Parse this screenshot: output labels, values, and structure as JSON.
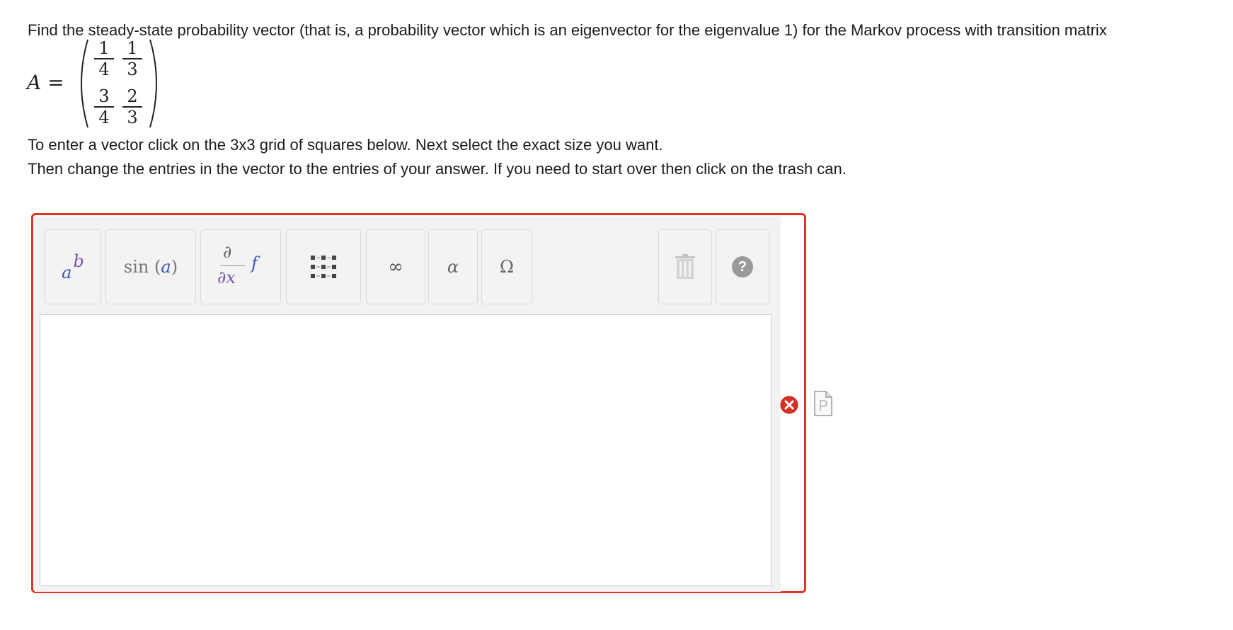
{
  "question": {
    "prompt": "Find the steady-state probability vector (that is, a probability vector which is an eigenvector for the eigenvalue 1) for the Markov process with transition matrix",
    "matrix_lhs_var": "A",
    "matrix_lhs_eq": "=",
    "matrix": [
      [
        {
          "num": "1",
          "den": "4"
        },
        {
          "num": "1",
          "den": "3"
        }
      ],
      [
        {
          "num": "3",
          "den": "4"
        },
        {
          "num": "2",
          "den": "3"
        }
      ]
    ],
    "instructions_1": "To enter a vector click on the 3x3 grid of squares below. Next select the exact size you want.",
    "instructions_2": "Then change the entries in the vector to the entries of your answer. If you need to start over then click on the trash can."
  },
  "toolbar": {
    "superscript": {
      "base": "a",
      "exp": "b"
    },
    "functions": {
      "fn": "sin",
      "open": "(",
      "arg": "a",
      "close": ")"
    },
    "calculus": {
      "partial_top": "∂",
      "partial_bottom": "∂x",
      "f": "f"
    },
    "infinity": "∞",
    "greek_alpha": "α",
    "greek_omega": "Ω",
    "help": "?"
  },
  "answer": {
    "value": ""
  },
  "colors": {
    "error_border": "#e0352b",
    "accent_purple": "#7a57a8",
    "accent_blue": "#3a55b8"
  }
}
